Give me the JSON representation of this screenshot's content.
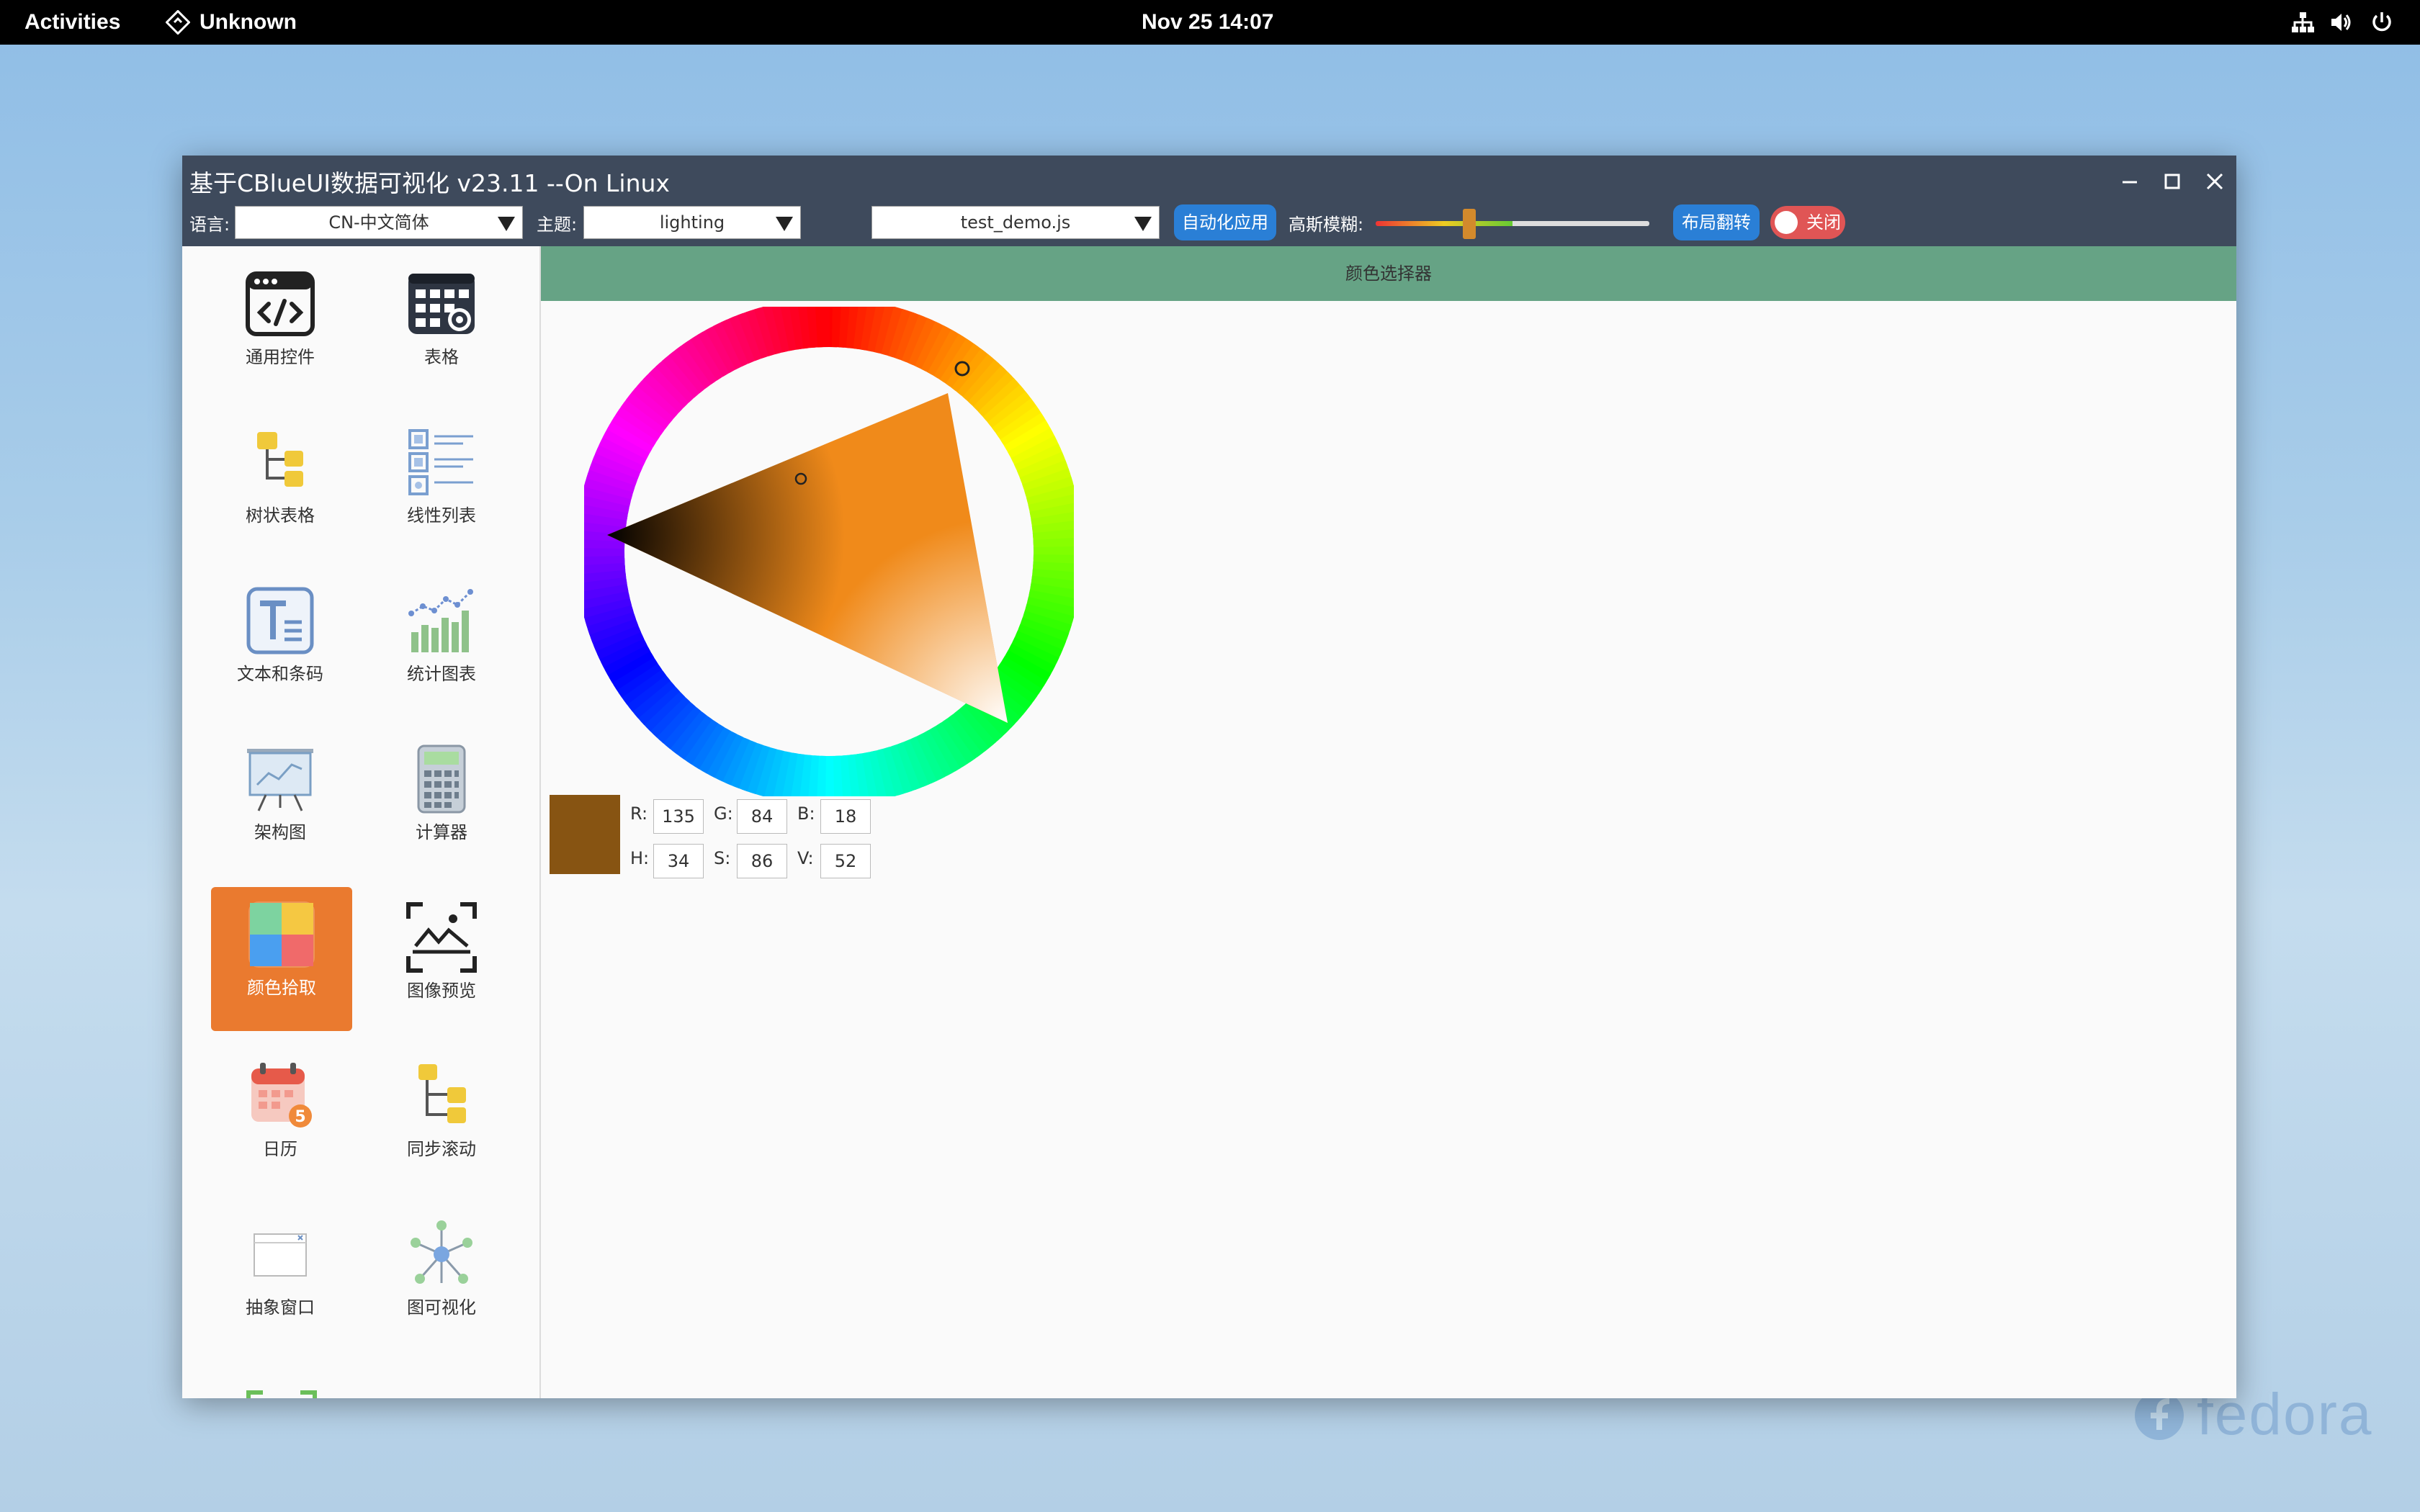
{
  "topbar": {
    "activities": "Activities",
    "app_name": "Unknown",
    "datetime": "Nov 25  14:07"
  },
  "wallpaper": {
    "brand": "fedora"
  },
  "window": {
    "title": "基于CBlueUI数据可视化 v23.11 --On Linux",
    "toolbar": {
      "language_label": "语言:",
      "language_value": "CN-中文简体",
      "theme_label": "主题:",
      "theme_value": "lighting",
      "script_value": "test_demo.js",
      "auto_apply_label": "自动化应用",
      "blur_label": "高斯模糊:",
      "blur_level_fraction": 0.33,
      "layout_flip_label": "布局翻转",
      "close_toggle_label": "关闭"
    },
    "sidebar": {
      "items": [
        {
          "label": "通用控件",
          "icon": "code-window-icon"
        },
        {
          "label": "表格",
          "icon": "table-settings-icon"
        },
        {
          "label": "树状表格",
          "icon": "tree-table-icon"
        },
        {
          "label": "线性列表",
          "icon": "linear-list-icon"
        },
        {
          "label": "文本和条码",
          "icon": "text-icon"
        },
        {
          "label": "统计图表",
          "icon": "stats-chart-icon"
        },
        {
          "label": "架构图",
          "icon": "presentation-board-icon"
        },
        {
          "label": "计算器",
          "icon": "calculator-icon"
        },
        {
          "label": "颜色拾取",
          "icon": "color-picker-icon",
          "active": true
        },
        {
          "label": "图像预览",
          "icon": "image-preview-icon"
        },
        {
          "label": "日历",
          "icon": "calendar-icon"
        },
        {
          "label": "同步滚动",
          "icon": "sync-scroll-icon"
        },
        {
          "label": "抽象窗口",
          "icon": "abstract-window-icon"
        },
        {
          "label": "图可视化",
          "icon": "graph-visualization-icon"
        }
      ]
    },
    "content": {
      "header": "颜色选择器",
      "color": {
        "swatch_hex": "#875412",
        "labels": {
          "r": "R:",
          "g": "G:",
          "b": "B:",
          "h": "H:",
          "s": "S:",
          "v": "V:"
        },
        "r": "135",
        "g": "84",
        "b": "18",
        "h": "34",
        "s": "86",
        "v": "52"
      }
    }
  },
  "colors": {
    "titlebar": "#3e4a5c",
    "content_header": "#66a385",
    "active_nav": "#ea7a2f",
    "button_blue": "#2a7fd6",
    "toggle_red": "#e05555"
  }
}
